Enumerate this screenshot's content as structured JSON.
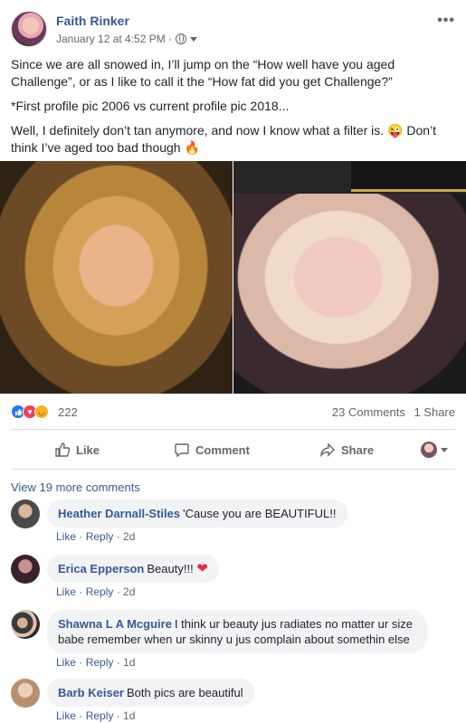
{
  "post": {
    "author": "Faith Rinker",
    "timestamp": "January 12 at 4:52 PM ·",
    "more_icon": "•••",
    "paragraphs": [
      "Since we are all snowed in, I’ll jump on the “How well have you aged Challenge”, or as I like to call it the “How fat did you get Challenge?”",
      "*First profile pic 2006 vs current profile pic 2018...",
      "Well, I definitely don’t tan anymore, and now I know what a filter is. 😜 Don’t think I’ve aged too bad though 🔥"
    ]
  },
  "reactions": {
    "count": "222",
    "comments": "23 Comments",
    "shares": "1 Share"
  },
  "actions": {
    "like": "Like",
    "comment": "Comment",
    "share": "Share"
  },
  "comments": {
    "view_more": "View 19 more comments",
    "like_label": "Like",
    "reply_label": "Reply",
    "items": [
      {
        "name": "Heather Darnall-Stiles",
        "text": "'Cause you are BEAUTIFUL!!",
        "age": "2d"
      },
      {
        "name": "Erica Epperson",
        "text": "Beauty!!!",
        "age": "2d"
      },
      {
        "name": "Shawna L A Mcguire",
        "text": "I think ur beauty jus radiates no matter ur size babe remember when ur skinny u jus complain about somethin else",
        "age": "1d"
      },
      {
        "name": "Barb Keiser",
        "text": "Both pics are beautiful",
        "age": "1d"
      }
    ]
  },
  "colors": {
    "link": "#385898",
    "author": "#365899",
    "muted": "#606770",
    "bubble": "#f2f3f5"
  },
  "icons": [
    "globe-icon",
    "caret-down-icon",
    "like-icon",
    "comment-icon",
    "share-icon",
    "love-reaction-icon",
    "haha-reaction-icon",
    "heart-emoji"
  ]
}
